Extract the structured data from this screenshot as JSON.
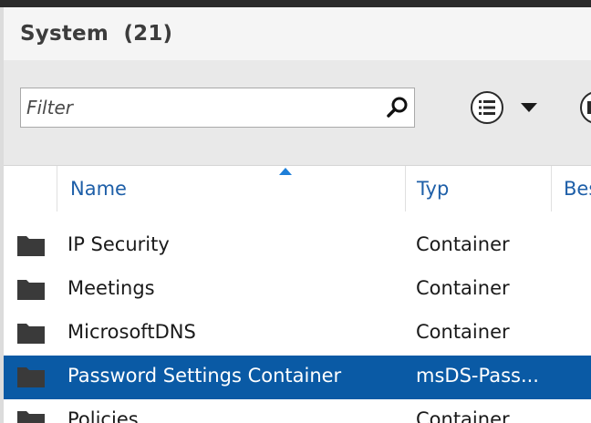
{
  "panel": {
    "title": "System",
    "count": "(21)"
  },
  "toolbar": {
    "filter_placeholder": "Filter",
    "search_icon": "search-icon",
    "view_icon": "list-icon",
    "dropdown_icon": "chevron-down-icon"
  },
  "columns": [
    {
      "label": "Name",
      "sorted": "ascending"
    },
    {
      "label": "Typ"
    },
    {
      "label": "Bes"
    }
  ],
  "rows": [
    {
      "name": "IP Security",
      "type": "Container",
      "selected": false
    },
    {
      "name": "Meetings",
      "type": "Container",
      "selected": false
    },
    {
      "name": "MicrosoftDNS",
      "type": "Container",
      "selected": false
    },
    {
      "name": "Password Settings Container",
      "type": "msDS-Pass...",
      "selected": true
    },
    {
      "name": "Policies",
      "type": "Container",
      "selected": false
    }
  ],
  "colors": {
    "selection": "#0a5aa5",
    "column_header_text": "#1e5fa8",
    "sort_arrow": "#1e7fd8"
  }
}
